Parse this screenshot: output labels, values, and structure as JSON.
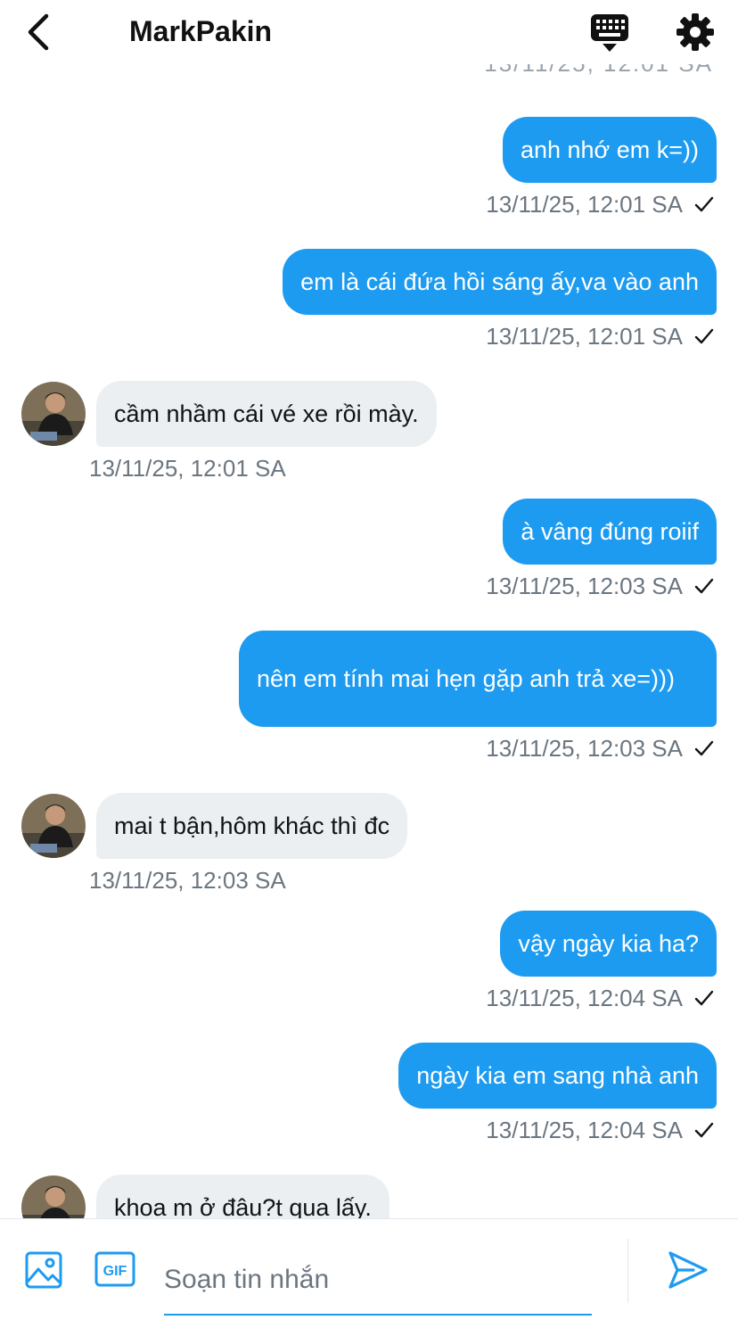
{
  "header": {
    "contact_name": "MarkPakin",
    "back_icon": "chevron-left-icon",
    "keyboard_icon": "keyboard-icon",
    "settings_icon": "gear-icon"
  },
  "colors": {
    "accent": "#1d9bf0",
    "incoming_bubble": "#eceff1",
    "timestamp": "#6b7680"
  },
  "messages": [
    {
      "direction": "out",
      "text": "anh nhớ em k=))",
      "time": "13/11/25, 12:01 SA",
      "status": "sent"
    },
    {
      "direction": "out",
      "text": "em là cái đứa hồi sáng ấy,va vào anh",
      "time": "13/11/25, 12:01 SA",
      "status": "sent"
    },
    {
      "direction": "in",
      "text": "cầm nhầm cái vé xe rồi mày.",
      "time": "13/11/25, 12:01 SA"
    },
    {
      "direction": "out",
      "text": "à vâng đúng roiif",
      "time": "13/11/25, 12:03 SA",
      "status": "sent"
    },
    {
      "direction": "out",
      "text": "nên em tính mai hẹn gặp anh trả xe=)))",
      "time": "13/11/25, 12:03 SA",
      "status": "sent"
    },
    {
      "direction": "in",
      "text": "mai t bận,hôm khác thì đc",
      "time": "13/11/25, 12:03 SA"
    },
    {
      "direction": "out",
      "text": "vậy ngày kia ha?",
      "time": "13/11/25, 12:04 SA",
      "status": "sent"
    },
    {
      "direction": "out",
      "text": "ngày kia em sang nhà anh",
      "time": "13/11/25, 12:04 SA",
      "status": "sent"
    },
    {
      "direction": "in",
      "text": "khoa m ở đâu?t qua lấy."
    }
  ],
  "composer": {
    "placeholder": "Soạn tin nhắn",
    "media_icon": "image-icon",
    "gif_icon": "gif-icon",
    "send_icon": "send-icon"
  }
}
